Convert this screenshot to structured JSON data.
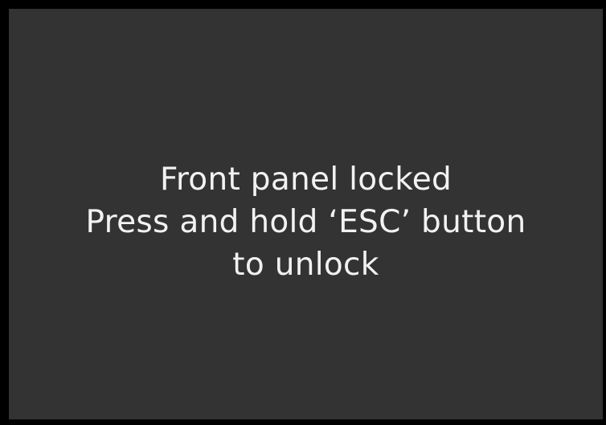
{
  "screen": {
    "background_color": "#333333",
    "text_color": "#f2f2f2",
    "message_lines": [
      "Front panel locked",
      "Press and hold ‘ESC’ button",
      "to unlock"
    ]
  }
}
